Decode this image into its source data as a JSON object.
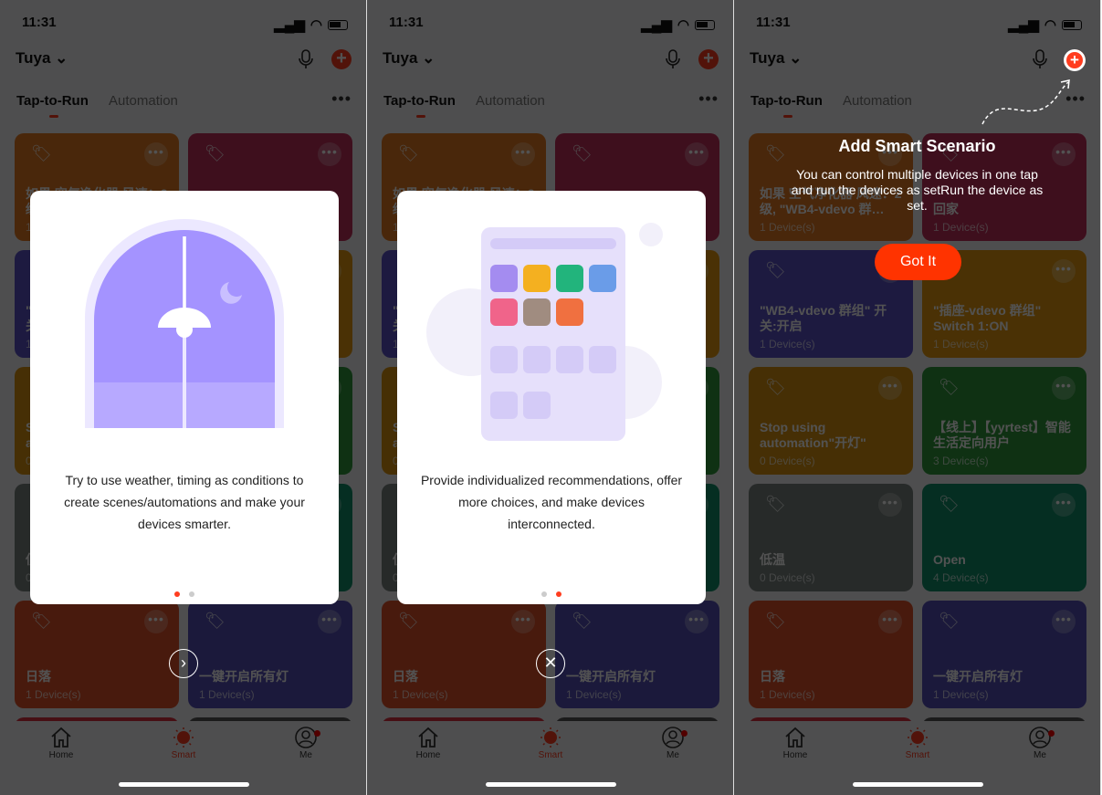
{
  "status": {
    "time": "11:31"
  },
  "header": {
    "home_name": "Tuya",
    "tabs": [
      "Tap-to-Run",
      "Automation"
    ]
  },
  "cards": [
    {
      "name": "如果 空气净化器 风速：2级, \"WB4-vdevo 群…",
      "count": "1 Device(s)",
      "color": "#e47a22"
    },
    {
      "name": "回家",
      "count": "1 Device(s)",
      "color": "#c2305c"
    },
    {
      "name": " \"WB4-vdevo 群组\" 开关:开启",
      "count": "1 Device(s)",
      "color": "#5b52c8"
    },
    {
      "name": " \"插座-vdevo 群组\" Switch 1:ON",
      "count": "1 Device(s)",
      "color": "#e59a10"
    },
    {
      "name": " Stop using automation\"开灯\"",
      "count": "0 Device(s)",
      "color": "#d99410"
    },
    {
      "name": "【线上】【yyrtest】智能生活定向用户",
      "count": "3 Device(s)",
      "color": "#2f9a3c"
    },
    {
      "name": "低温",
      "count": "0 Device(s)",
      "color": "#7a8480"
    },
    {
      "name": "Open",
      "count": "4 Device(s)",
      "color": "#12906a"
    },
    {
      "name": "日落",
      "count": "1 Device(s)",
      "color": "#e0522a"
    },
    {
      "name": "一键开启所有灯",
      "count": "1 Device(s)",
      "color": "#5550b8"
    },
    {
      "name": "",
      "count": "",
      "color": "#d83040"
    },
    {
      "name": "",
      "count": "",
      "color": "#555"
    }
  ],
  "tabbar": [
    {
      "label": "Home",
      "icon": "home-icon"
    },
    {
      "label": "Smart",
      "icon": "sun-icon"
    },
    {
      "label": "Me",
      "icon": "user-icon"
    }
  ],
  "colors": {
    "accent": "#ff3d1f"
  },
  "screens": [
    {
      "type": "onboarding",
      "text": "Try to use weather, timing as conditions to create scenes/automations and make your devices smarter.",
      "page": 1,
      "pages": 2,
      "button_icon": "chevron-right-icon"
    },
    {
      "type": "onboarding",
      "text": "Provide individualized recommendations, offer more choices, and make devices interconnected.",
      "page": 2,
      "pages": 2,
      "button_icon": "close-icon"
    },
    {
      "type": "tip",
      "title": "Add Smart Scenario",
      "text": "You can control multiple devices in one tap and run the devices as setRun the device as set.",
      "button": "Got It"
    }
  ]
}
